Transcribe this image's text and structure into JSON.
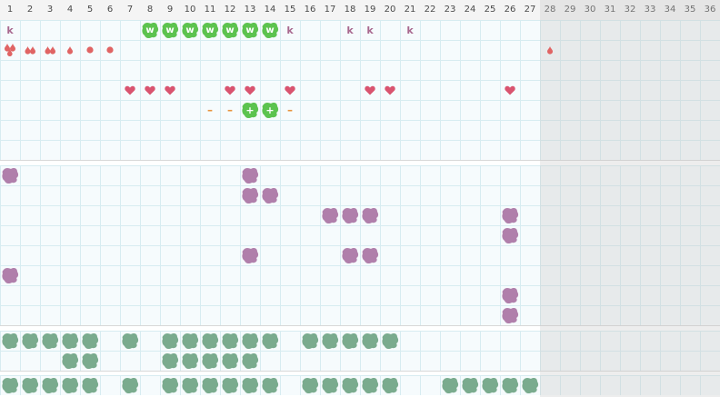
{
  "days": [
    "1",
    "2",
    "3",
    "4",
    "5",
    "6",
    "7",
    "8",
    "9",
    "10",
    "11",
    "12",
    "13",
    "14",
    "15",
    "16",
    "17",
    "18",
    "19",
    "20",
    "21",
    "22",
    "23",
    "24",
    "25",
    "26",
    "27",
    "28",
    "29",
    "30",
    "31",
    "32",
    "33",
    "34",
    "35",
    "36"
  ],
  "today_day": "28",
  "colors": {
    "drop": "#e06464",
    "heart": "#d9536f",
    "letter": "#a8688f",
    "dash": "#e8923b",
    "blob_green_bright": "#5cc34f",
    "blob_purple": "#b07fab",
    "blob_teal": "#7aab8e"
  },
  "symbols": {
    "k": "k",
    "w": "w",
    "plus": "+",
    "dash": "–"
  },
  "rows": {
    "row1": [
      {
        "day": "1",
        "kind": "k"
      },
      {
        "day": "8",
        "kind": "w"
      },
      {
        "day": "9",
        "kind": "w"
      },
      {
        "day": "10",
        "kind": "w"
      },
      {
        "day": "11",
        "kind": "w"
      },
      {
        "day": "12",
        "kind": "w"
      },
      {
        "day": "13",
        "kind": "w"
      },
      {
        "day": "14",
        "kind": "w"
      },
      {
        "day": "15",
        "kind": "k"
      },
      {
        "day": "18",
        "kind": "k"
      },
      {
        "day": "19",
        "kind": "k"
      },
      {
        "day": "21",
        "kind": "k"
      }
    ],
    "row2": [
      {
        "day": "1",
        "kind": "drop-heavy"
      },
      {
        "day": "2",
        "kind": "drop-medium"
      },
      {
        "day": "3",
        "kind": "drop-medium"
      },
      {
        "day": "4",
        "kind": "drop-light"
      },
      {
        "day": "5",
        "kind": "spot"
      },
      {
        "day": "6",
        "kind": "spot"
      },
      {
        "day": "28",
        "kind": "drop-light"
      }
    ],
    "row4": [
      {
        "day": "7",
        "kind": "heart"
      },
      {
        "day": "8",
        "kind": "heart"
      },
      {
        "day": "9",
        "kind": "heart"
      },
      {
        "day": "12",
        "kind": "heart"
      },
      {
        "day": "13",
        "kind": "heart"
      },
      {
        "day": "15",
        "kind": "heart"
      },
      {
        "day": "19",
        "kind": "heart"
      },
      {
        "day": "20",
        "kind": "heart"
      },
      {
        "day": "26",
        "kind": "heart"
      }
    ],
    "row5": [
      {
        "day": "11",
        "kind": "dash"
      },
      {
        "day": "12",
        "kind": "dash"
      },
      {
        "day": "13",
        "kind": "plus"
      },
      {
        "day": "14",
        "kind": "plus"
      },
      {
        "day": "15",
        "kind": "dash"
      }
    ]
  },
  "purple_marks": [
    {
      "row": 1,
      "day": "1"
    },
    {
      "row": 1,
      "day": "13"
    },
    {
      "row": 2,
      "day": "13"
    },
    {
      "row": 2,
      "day": "14"
    },
    {
      "row": 3,
      "day": "17"
    },
    {
      "row": 3,
      "day": "18"
    },
    {
      "row": 3,
      "day": "19"
    },
    {
      "row": 3,
      "day": "26"
    },
    {
      "row": 4,
      "day": "26"
    },
    {
      "row": 5,
      "day": "13"
    },
    {
      "row": 5,
      "day": "18"
    },
    {
      "row": 5,
      "day": "19"
    },
    {
      "row": 6,
      "day": "1"
    },
    {
      "row": 7,
      "day": "26"
    },
    {
      "row": 8,
      "day": "26"
    }
  ],
  "teal_marks": {
    "row1": [
      "1",
      "2",
      "3",
      "4",
      "5",
      "7",
      "9",
      "10",
      "11",
      "12",
      "13",
      "14",
      "16",
      "17",
      "18",
      "19",
      "20"
    ],
    "row2": [
      "4",
      "5",
      "9",
      "10",
      "11",
      "12",
      "13"
    ],
    "row3": [
      "1",
      "2",
      "3",
      "4",
      "5",
      "7",
      "9",
      "10",
      "11",
      "12",
      "13",
      "14",
      "16",
      "17",
      "18",
      "19",
      "20",
      "23",
      "24",
      "25",
      "26",
      "27"
    ]
  }
}
